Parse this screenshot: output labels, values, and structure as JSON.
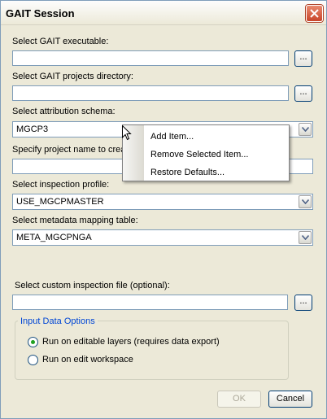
{
  "window": {
    "title": "GAIT Session"
  },
  "fields": {
    "executable_label": "Select GAIT executable:",
    "executable_value": "",
    "projects_dir_label": "Select GAIT projects directory:",
    "projects_dir_value": "",
    "schema_label": "Select attribution schema:",
    "schema_value": "MGCP3",
    "project_name_label": "Specify project name to crea",
    "project_name_value": "",
    "inspection_profile_label": "Select inspection profile:",
    "inspection_profile_value": "USE_MGCPMASTER",
    "metadata_label": "Select metadata mapping table:",
    "metadata_value": "META_MGCPNGA",
    "custom_inspection_label": "Select custom inspection file (optional):",
    "custom_inspection_value": "",
    "browse_label": "..."
  },
  "input_options": {
    "legend": "Input Data Options",
    "options": [
      {
        "label": "Run on editable layers (requires data export)",
        "selected": true
      },
      {
        "label": "Run on edit workspace",
        "selected": false
      }
    ]
  },
  "context_menu": {
    "items": [
      "Add Item...",
      "Remove Selected Item...",
      "Restore Defaults..."
    ]
  },
  "buttons": {
    "ok": "OK",
    "cancel": "Cancel"
  },
  "colors": {
    "legend": "#0046d5",
    "radio_selected": "#21a121",
    "dialog_bg": "#ece9d8"
  }
}
